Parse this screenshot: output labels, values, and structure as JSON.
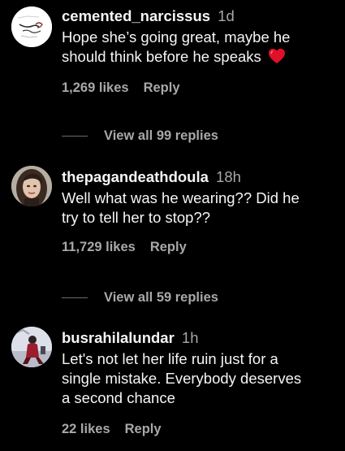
{
  "comments": [
    {
      "username": "cemented_narcissus",
      "time": "1d",
      "text_lines": [
        "Hope she’s going great, maybe he",
        "should think before he speaks"
      ],
      "has_heart_emoji": true,
      "likes": "1,269 likes",
      "reply_label": "Reply",
      "view_replies": "View all 99 replies",
      "avatar_icon": "sketch-avatar"
    },
    {
      "username": "thepagandeathdoula",
      "time": "18h",
      "text_lines": [
        "Well what was he wearing?? Did he",
        "try to tell her to stop??"
      ],
      "has_heart_emoji": false,
      "likes": "11,729 likes",
      "reply_label": "Reply",
      "view_replies": "View all 59 replies",
      "avatar_icon": "photo-avatar"
    },
    {
      "username": "busrahilalundar",
      "time": "1h",
      "text_lines": [
        "Let's not let her life ruin just for a",
        "single mistake. Everybody deserves",
        "a second chance"
      ],
      "has_heart_emoji": false,
      "likes": "22 likes",
      "reply_label": "Reply",
      "avatar_icon": "photo-avatar"
    }
  ],
  "colors": {
    "background": "#000000",
    "primary_text": "#f5f5f5",
    "secondary_text": "#a8a8a8",
    "heart": "#e0102a"
  }
}
